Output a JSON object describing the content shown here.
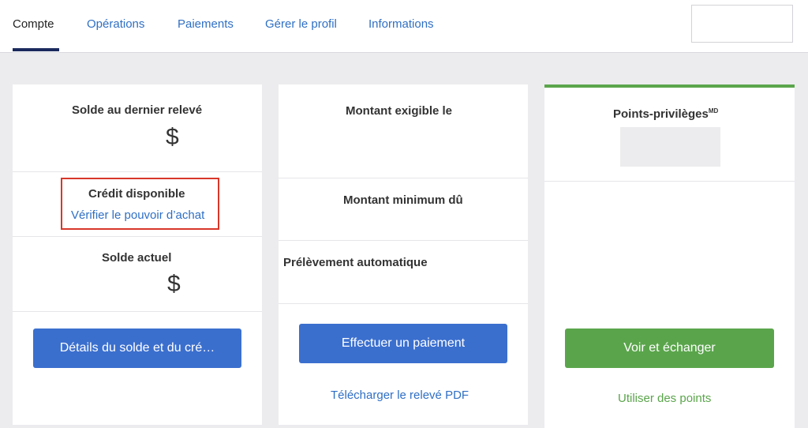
{
  "nav": {
    "tabs": [
      {
        "label": "Compte",
        "active": true
      },
      {
        "label": "Opérations",
        "active": false
      },
      {
        "label": "Paiements",
        "active": false
      },
      {
        "label": "Gérer le profil",
        "active": false
      },
      {
        "label": "Informations",
        "active": false
      }
    ]
  },
  "balance_card": {
    "last_statement_label": "Solde au dernier relevé",
    "last_statement_value": "$",
    "available_credit_label": "Crédit disponible",
    "check_purchase_link": "Vérifier le pouvoir d’achat",
    "current_balance_label": "Solde actuel",
    "current_balance_value": "$",
    "details_button": "Détails du solde et du cré…"
  },
  "payment_card": {
    "due_label": "Montant exigible le",
    "minimum_label": "Montant minimum dû",
    "autopay_label": "Prélèvement automatique",
    "pay_button": "Effectuer un paiement",
    "download_link": "Télécharger le relevé PDF"
  },
  "points_card": {
    "title": "Points-privilèges",
    "title_sup": "MD",
    "view_button": "Voir et échanger",
    "use_points_link": "Utiliser des points"
  },
  "colors": {
    "accent_blue": "#3b6fce",
    "accent_green": "#5aa54b",
    "highlight_red": "#d8372a",
    "nav_active_underline": "#1b2a5e"
  }
}
